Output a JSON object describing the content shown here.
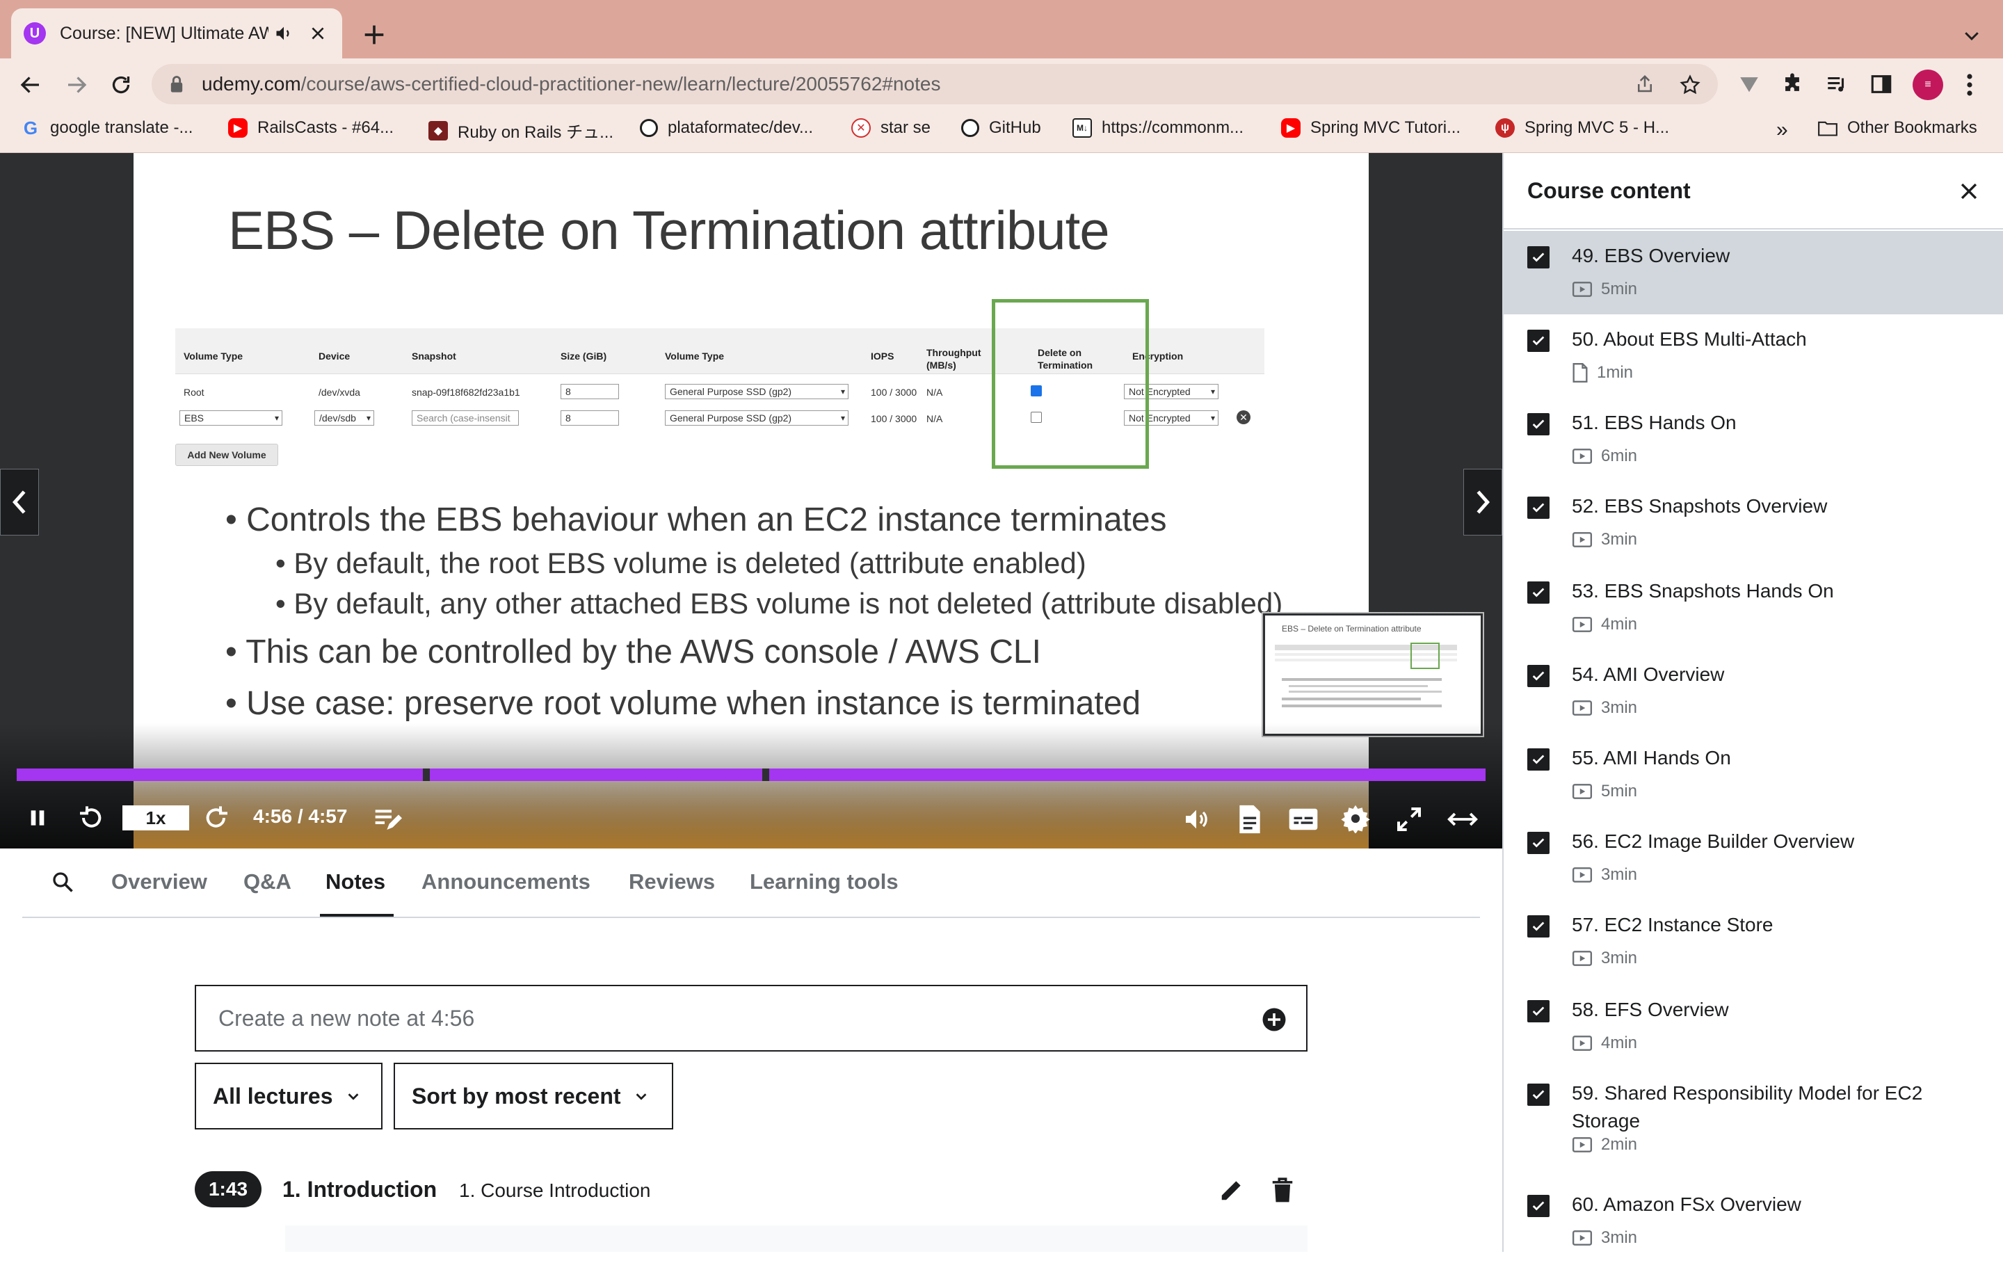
{
  "browser": {
    "tab_title": "Course: [NEW] Ultimate AW",
    "favicon_letter": "U",
    "url_host": "udemy.com",
    "url_path": "/course/aws-certified-cloud-practitioner-new/learn/lecture/20055762#notes",
    "bookmarks": [
      {
        "label": "google translate -..."
      },
      {
        "label": "RailsCasts - #64..."
      },
      {
        "label": "Ruby on Rails チュ..."
      },
      {
        "label": "plataformatec/dev..."
      },
      {
        "label": "star se"
      },
      {
        "label": "GitHub"
      },
      {
        "label": "https://commonm..."
      },
      {
        "label": "Spring MVC Tutori..."
      },
      {
        "label": "Spring MVC 5 - H..."
      }
    ],
    "bookmarks_overflow": "»",
    "other_bookmarks": "Other Bookmarks",
    "accent": "#a435f0"
  },
  "slide": {
    "title": "EBS – Delete on Termination attribute",
    "table_headers": [
      "Volume Type",
      "Device",
      "Snapshot",
      "Size (GiB)",
      "Volume Type",
      "IOPS",
      "Throughput (MB/s)",
      "Delete on Termination",
      "Encryption"
    ],
    "rows": [
      {
        "type": "Root",
        "device": "/dev/xvda",
        "snapshot": "snap-09f18f682fd23a1b1",
        "size": "8",
        "vtype": "General Purpose SSD (gp2)",
        "iops": "100 / 3000",
        "tput": "N/A",
        "enc": "Not Encrypted"
      },
      {
        "type": "EBS",
        "device": "/dev/sdb",
        "snapshot": "Search (case-insensit",
        "size": "8",
        "vtype": "General Purpose SSD (gp2)",
        "iops": "100 / 3000",
        "tput": "N/A",
        "enc": "Not Encrypted"
      }
    ],
    "add_volume": "Add New Volume",
    "bullets": {
      "b1": "Controls the EBS behaviour when an EC2 instance terminates",
      "b1a": "By default, the root EBS volume is deleted (attribute enabled)",
      "b1b": "By default, any other attached EBS volume is not deleted (attribute disabled)",
      "b2": "This can be controlled by the AWS console / AWS CLI",
      "b3": "Use case: preserve root volume when instance is terminated"
    },
    "thumb_title": "EBS – Delete on Termination attribute"
  },
  "player": {
    "speed": "1x",
    "time": "4:56 / 4:57",
    "progress": 0.997
  },
  "tabs": [
    "Overview",
    "Q&A",
    "Notes",
    "Announcements",
    "Reviews",
    "Learning tools"
  ],
  "active_tab": "Notes",
  "notes": {
    "placeholder": "Create a new note at 4:56",
    "filter_lectures": "All lectures",
    "filter_sort": "Sort by most recent",
    "items": [
      {
        "time": "1:43",
        "section": "1. Introduction",
        "lecture": "1. Course Introduction"
      }
    ]
  },
  "sidebar": {
    "title": "Course content",
    "items": [
      {
        "title": "49. EBS Overview",
        "duration": "5min",
        "kind": "video",
        "current": true
      },
      {
        "title": "50. About EBS Multi-Attach",
        "duration": "1min",
        "kind": "article"
      },
      {
        "title": "51. EBS Hands On",
        "duration": "6min",
        "kind": "video"
      },
      {
        "title": "52. EBS Snapshots Overview",
        "duration": "3min",
        "kind": "video"
      },
      {
        "title": "53. EBS Snapshots Hands On",
        "duration": "4min",
        "kind": "video"
      },
      {
        "title": "54. AMI Overview",
        "duration": "3min",
        "kind": "video"
      },
      {
        "title": "55. AMI Hands On",
        "duration": "5min",
        "kind": "video"
      },
      {
        "title": "56. EC2 Image Builder Overview",
        "duration": "3min",
        "kind": "video"
      },
      {
        "title": "57. EC2 Instance Store",
        "duration": "3min",
        "kind": "video"
      },
      {
        "title": "58. EFS Overview",
        "duration": "4min",
        "kind": "video"
      },
      {
        "title": "59. Shared Responsibility Model for EC2 Storage",
        "duration": "2min",
        "kind": "video"
      },
      {
        "title": "60. Amazon FSx Overview",
        "duration": "3min",
        "kind": "video"
      }
    ]
  }
}
